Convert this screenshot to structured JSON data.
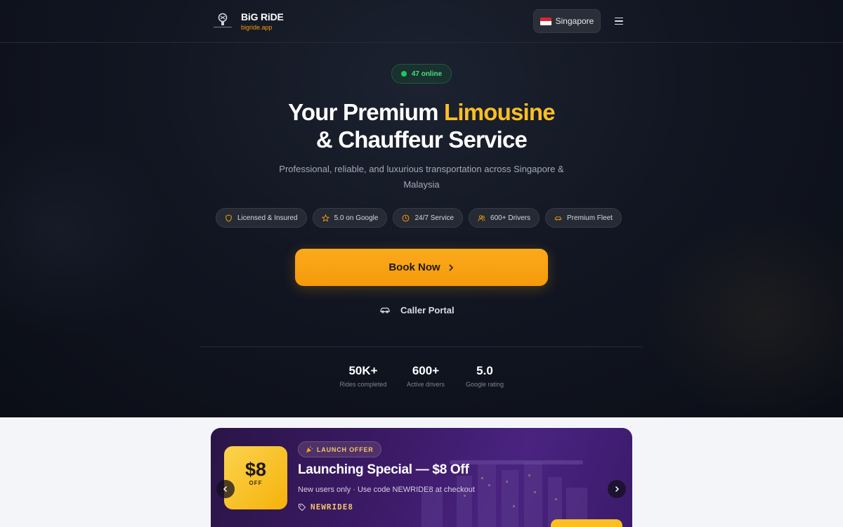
{
  "header": {
    "brand": "BiG RiDE",
    "domain": "bigride.app",
    "country": "Singapore",
    "logo_icon": "car-logo-icon",
    "menu_icon": "hamburger-icon"
  },
  "hero": {
    "online_text": "47 online",
    "headline_part1": "Your Premium ",
    "headline_accent": "Limousine",
    "headline_part2": "& Chauffeur Service",
    "subtitle": "Professional, reliable, and luxurious transportation across Singapore & Malaysia",
    "badges": [
      {
        "label": "Licensed & Insured",
        "icon": "shield-icon"
      },
      {
        "label": "5.0 on Google",
        "icon": "star-icon"
      },
      {
        "label": "24/7 Service",
        "icon": "clock-icon"
      },
      {
        "label": "600+ Drivers",
        "icon": "users-icon"
      },
      {
        "label": "Premium Fleet",
        "icon": "car-icon"
      }
    ],
    "book_label": "Book Now",
    "caller_label": "Caller Portal",
    "stats": [
      {
        "value": "50K+",
        "label": "Rides completed"
      },
      {
        "value": "600+",
        "label": "Active drivers"
      },
      {
        "value": "5.0",
        "label": "Google rating"
      }
    ]
  },
  "promo": {
    "amount": "$8",
    "off_label": "OFF",
    "pill": "LAUNCH OFFER",
    "pill_icon": "party-popper-icon",
    "title": "Launching Special — $8 Off",
    "subtitle": "New users only · Use code NEWRIDE8 at checkout",
    "code": "NEWRIDE8",
    "code_icon": "tag-icon"
  },
  "colors": {
    "accent": "#f59e0b",
    "online": "#22c55e",
    "promo_bg": "#3b1a66"
  }
}
